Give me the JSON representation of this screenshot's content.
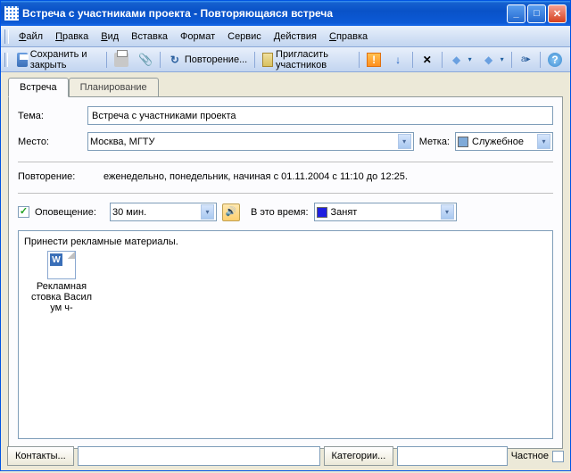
{
  "window": {
    "title": "Встреча с участниками проекта - Повторяющаяся встреча"
  },
  "menu": {
    "file": "Файл",
    "edit": "Правка",
    "view": "Вид",
    "insert": "Вставка",
    "format": "Формат",
    "tools": "Сервис",
    "actions": "Действия",
    "help": "Справка"
  },
  "toolbar": {
    "save_close": "Сохранить и закрыть",
    "recurrence": "Повторение...",
    "invite": "Пригласить участников"
  },
  "tabs": {
    "appointment": "Встреча",
    "scheduling": "Планирование"
  },
  "form": {
    "subject_label": "Тема:",
    "subject_value": "Встреча с участниками проекта",
    "location_label": "Место:",
    "location_value": "Москва, МГТУ",
    "label_label": "Метка:",
    "label_value": "Служебное",
    "recurrence_label": "Повторение:",
    "recurrence_text": "еженедельно, понедельник, начиная с 01.11.2004 с 11:10 до 12:25.",
    "reminder_label": "Оповещение:",
    "reminder_value": "30 мин.",
    "showas_label": "В это время:",
    "showas_value": "Занят",
    "notes_text": "Принести рекламные материалы.",
    "attachment_name": "Рекламная стовка Васил ум ч-"
  },
  "bottom": {
    "contacts": "Контакты...",
    "categories": "Категории...",
    "private": "Частное"
  },
  "colors": {
    "label_swatch": "#7faad8",
    "busy_swatch": "#2020e0"
  }
}
